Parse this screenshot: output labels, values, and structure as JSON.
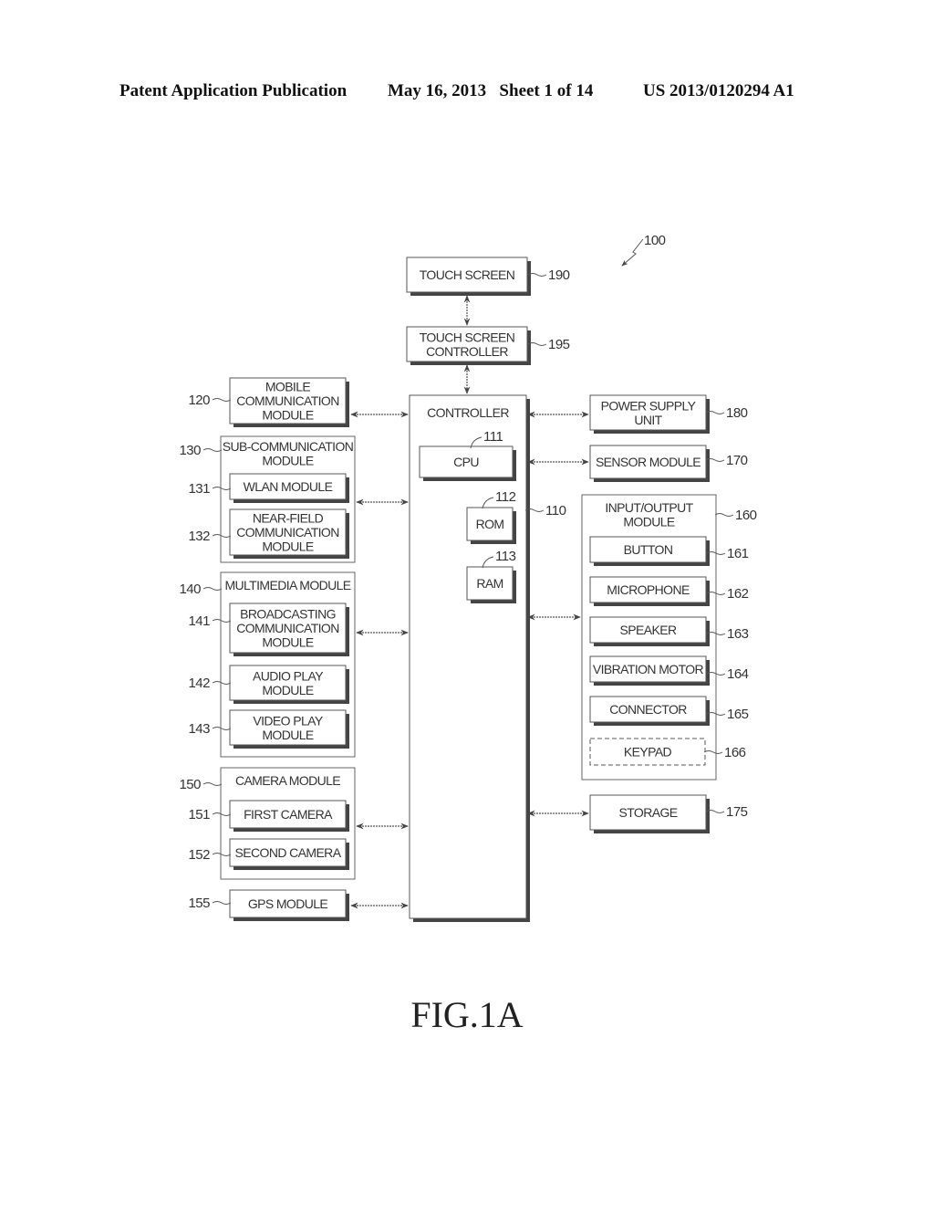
{
  "header": {
    "publication": "Patent Application Publication",
    "date_sheet": "May 16, 2013   Sheet 1 of 14",
    "number": "US 2013/0120294 A1"
  },
  "figure_label": "FIG.1A",
  "device_ref": "100",
  "blocks": {
    "touch_screen": {
      "lines": [
        "TOUCH SCREEN"
      ],
      "ref": "190"
    },
    "touch_screen_controller": {
      "lines": [
        "TOUCH SCREEN",
        "CONTROLLER"
      ],
      "ref": "195"
    },
    "controller": {
      "lines": [
        "CONTROLLER"
      ],
      "ref": "110"
    },
    "cpu": {
      "lines": [
        "CPU"
      ],
      "ref": "111"
    },
    "rom": {
      "lines": [
        "ROM"
      ],
      "ref": "112"
    },
    "ram": {
      "lines": [
        "RAM"
      ],
      "ref": "113"
    },
    "mobile_comm": {
      "lines": [
        "MOBILE",
        "COMMUNICATION",
        "MODULE"
      ],
      "ref": "120"
    },
    "sub_comm": {
      "lines": [
        "SUB-COMMUNICATION",
        "MODULE"
      ],
      "ref": "130"
    },
    "wlan": {
      "lines": [
        "WLAN MODULE"
      ],
      "ref": "131"
    },
    "near_field": {
      "lines": [
        "NEAR-FIELD",
        "COMMUNICATION",
        "MODULE"
      ],
      "ref": "132"
    },
    "multimedia": {
      "lines": [
        "MULTIMEDIA MODULE"
      ],
      "ref": "140"
    },
    "broadcasting": {
      "lines": [
        "BROADCASTING",
        "COMMUNICATION",
        "MODULE"
      ],
      "ref": "141"
    },
    "audio_play": {
      "lines": [
        "AUDIO PLAY",
        "MODULE"
      ],
      "ref": "142"
    },
    "video_play": {
      "lines": [
        "VIDEO PLAY",
        "MODULE"
      ],
      "ref": "143"
    },
    "camera": {
      "lines": [
        "CAMERA MODULE"
      ],
      "ref": "150"
    },
    "first_camera": {
      "lines": [
        "FIRST CAMERA"
      ],
      "ref": "151"
    },
    "second_camera": {
      "lines": [
        "SECOND CAMERA"
      ],
      "ref": "152"
    },
    "gps": {
      "lines": [
        "GPS MODULE"
      ],
      "ref": "155"
    },
    "power_supply": {
      "lines": [
        "POWER SUPPLY",
        "UNIT"
      ],
      "ref": "180"
    },
    "sensor": {
      "lines": [
        "SENSOR MODULE"
      ],
      "ref": "170"
    },
    "io_module": {
      "lines": [
        "INPUT/OUTPUT",
        "MODULE"
      ],
      "ref": "160"
    },
    "button": {
      "lines": [
        "BUTTON"
      ],
      "ref": "161"
    },
    "microphone": {
      "lines": [
        "MICROPHONE"
      ],
      "ref": "162"
    },
    "speaker": {
      "lines": [
        "SPEAKER"
      ],
      "ref": "163"
    },
    "vibration_motor": {
      "lines": [
        "VIBRATION MOTOR"
      ],
      "ref": "164"
    },
    "connector": {
      "lines": [
        "CONNECTOR"
      ],
      "ref": "165"
    },
    "keypad": {
      "lines": [
        "KEYPAD"
      ],
      "ref": "166",
      "optional": true
    },
    "storage": {
      "lines": [
        "STORAGE"
      ],
      "ref": "175"
    }
  }
}
